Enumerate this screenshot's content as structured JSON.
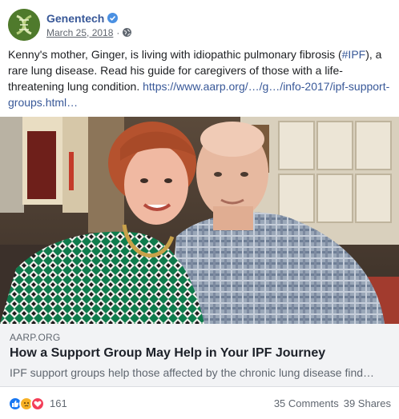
{
  "header": {
    "page_name": "Genentech",
    "date": "March 25, 2018",
    "separator": "·",
    "avatar_icon": "genentech-logo-icon",
    "verified_icon": "verified-badge-icon",
    "privacy_icon": "globe-icon"
  },
  "post": {
    "text_before_tag": "Kenny's mother, Ginger, is living with idiopathic pulmonary fibrosis (",
    "hashtag": "#IPF",
    "text_after_tag": "), a rare lung disease. Read his guide for caregivers of those with a life-threatening lung condition. ",
    "link": "https://www.aarp.org/…/g…/info-2017/ipf-support-groups.html…"
  },
  "photo": {
    "description_icon": "photo-couple"
  },
  "link_preview": {
    "domain": "AARP.ORG",
    "title": "How a Support Group May Help in Your IPF Journey",
    "description": "IPF support groups help those affected by the chronic lung disease find…"
  },
  "footer": {
    "reaction_icons": [
      "like-icon",
      "sad-icon",
      "love-icon"
    ],
    "reaction_count": "161",
    "comments": "35 Comments",
    "shares": "39 Shares"
  },
  "colors": {
    "brand_link": "#385898",
    "like": "#1877f2",
    "sad": "#f7b125",
    "love": "#f33e58"
  }
}
